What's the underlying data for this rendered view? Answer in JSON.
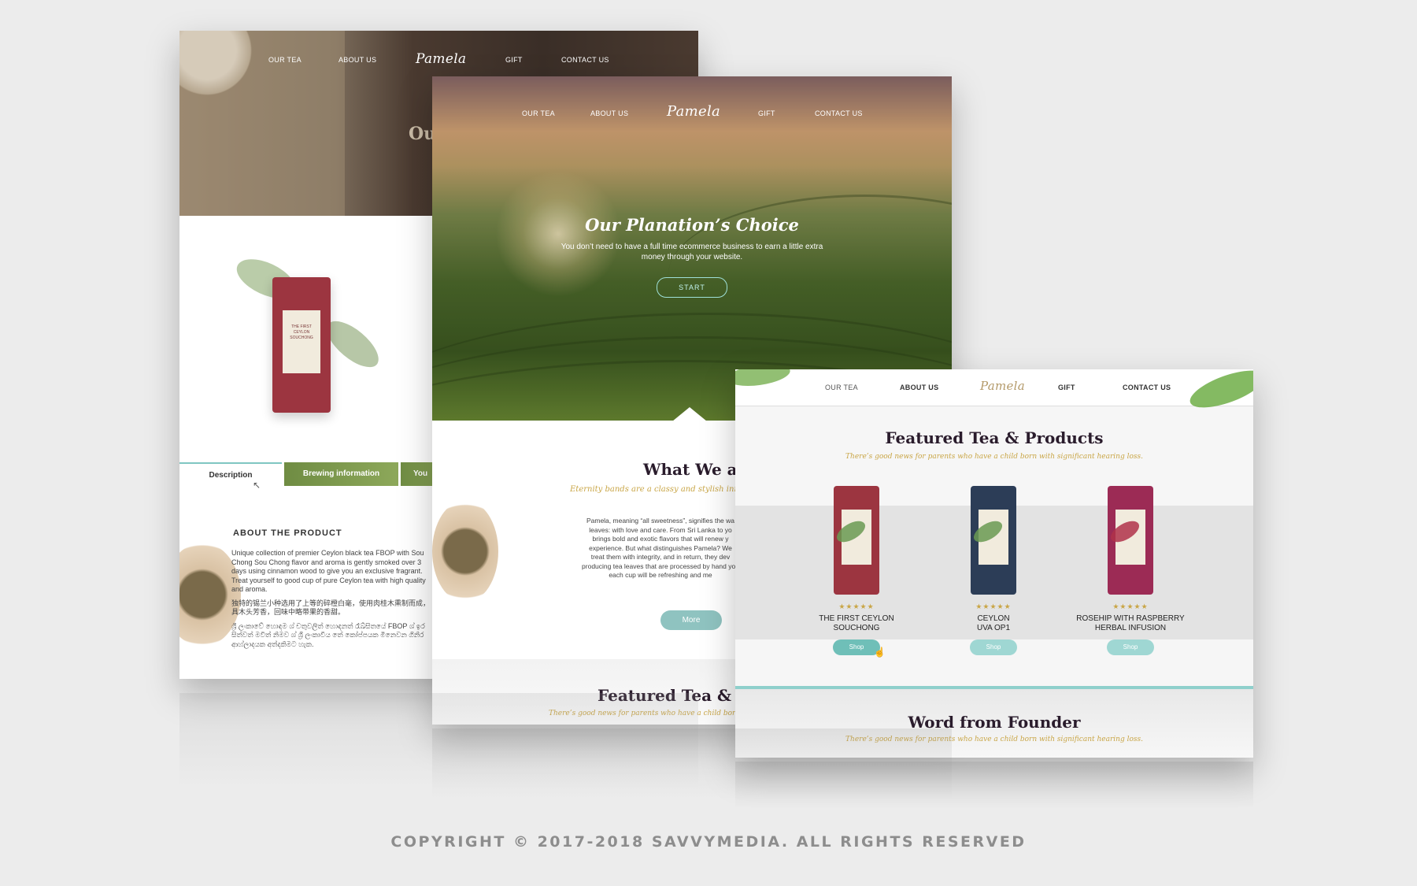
{
  "navigation": {
    "items": [
      "OUR TEA",
      "ABOUT US",
      "GIFT",
      "CONTACT US"
    ],
    "logo_text": "Pamela"
  },
  "page_product": {
    "hero_title_fragment": "Ou",
    "tin_label": [
      "THE FIRST",
      "CEYLON",
      "SOUCHONG"
    ],
    "tabs": [
      "Description",
      "Brewing information",
      "You"
    ],
    "about_heading": "ABOUT THE PRODUCT",
    "about_paragraphs": [
      "Unique collection of premier Ceylon black tea FBOP with Sou Chong Sou Chong flavor and aroma is gently smoked over 3 days using cinnamon wood to give you an exclusive fragrant. Treat yourself to good cup of pure Ceylon tea with high quality and aroma.",
      "独特的锡兰小种选用了上等的碎橙白毫，使用肉桂木熏制而成，具木头芳香，回味中略带果的香甜。",
      "ශ්‍රී ලංකාවේ හොඳම ශ් චතුවලිත් හොඳනත් රෑඛ්සිතයේ FBOP ශ් ඉර සිත්වත් මවිත් නිමව ශ් ශ්‍රී ලංකාවීය තේ කෝප්පයක මිනෙවන ගිනිර ආහ්ලාදයක අත්දකිමට හැක."
    ]
  },
  "page_home": {
    "hero_title": "Our Planation’s Choice",
    "hero_subtitle": "You don’t need to have a full time ecommerce business to earn a little extra money through your website.",
    "start_button": "START",
    "what_title": "What We are",
    "what_subtitle": "Eternity bands are a classy and stylish innovatio",
    "what_body": "Pamela, meaning “all sweetness”, signifies the wa leaves: with love and care. From Sri Lanka to yo brings bold and exotic flavors that will renew y experience. But what distinguishes Pamela? We treat them with integrity, and in return, they dev producing tea leaves that are processed by hand you each cup will be refreshing and me",
    "more_button": "More",
    "featured_title": "Featured Tea & Pr",
    "featured_subtitle": "There’s good news for parents who have a child born"
  },
  "page_featured": {
    "title": "Featured Tea & Products",
    "subtitle": "There’s good news for parents who have a child born with significant hearing loss.",
    "products": [
      {
        "name_line1": "THE FIRST CEYLON",
        "name_line2": "SOUCHONG",
        "stars": "★★★★★",
        "shop": "Shop",
        "color": "#9c3540"
      },
      {
        "name_line1": "CEYLON",
        "name_line2": "UVA OP1",
        "stars": "★★★★★",
        "shop": "Shop",
        "color": "#2c3d57"
      },
      {
        "name_line1": "ROSEHIP WITH RASPBERRY",
        "name_line2": "HERBAL INFUSION",
        "stars": "★★★★★",
        "shop": "Shop",
        "color": "#9c2b55"
      }
    ],
    "founder_title": "Word from Founder",
    "founder_subtitle": "There’s good news for parents who have a child born with significant hearing loss."
  },
  "footer": {
    "copyright": "COPYRIGHT © 2017-2018 SAVVYMEDIA. ALL RIGHTS RESERVED"
  },
  "colors": {
    "accent_teal": "#7fc6c2",
    "gold": "#c9a647",
    "dark_title": "#2a1c2c"
  }
}
